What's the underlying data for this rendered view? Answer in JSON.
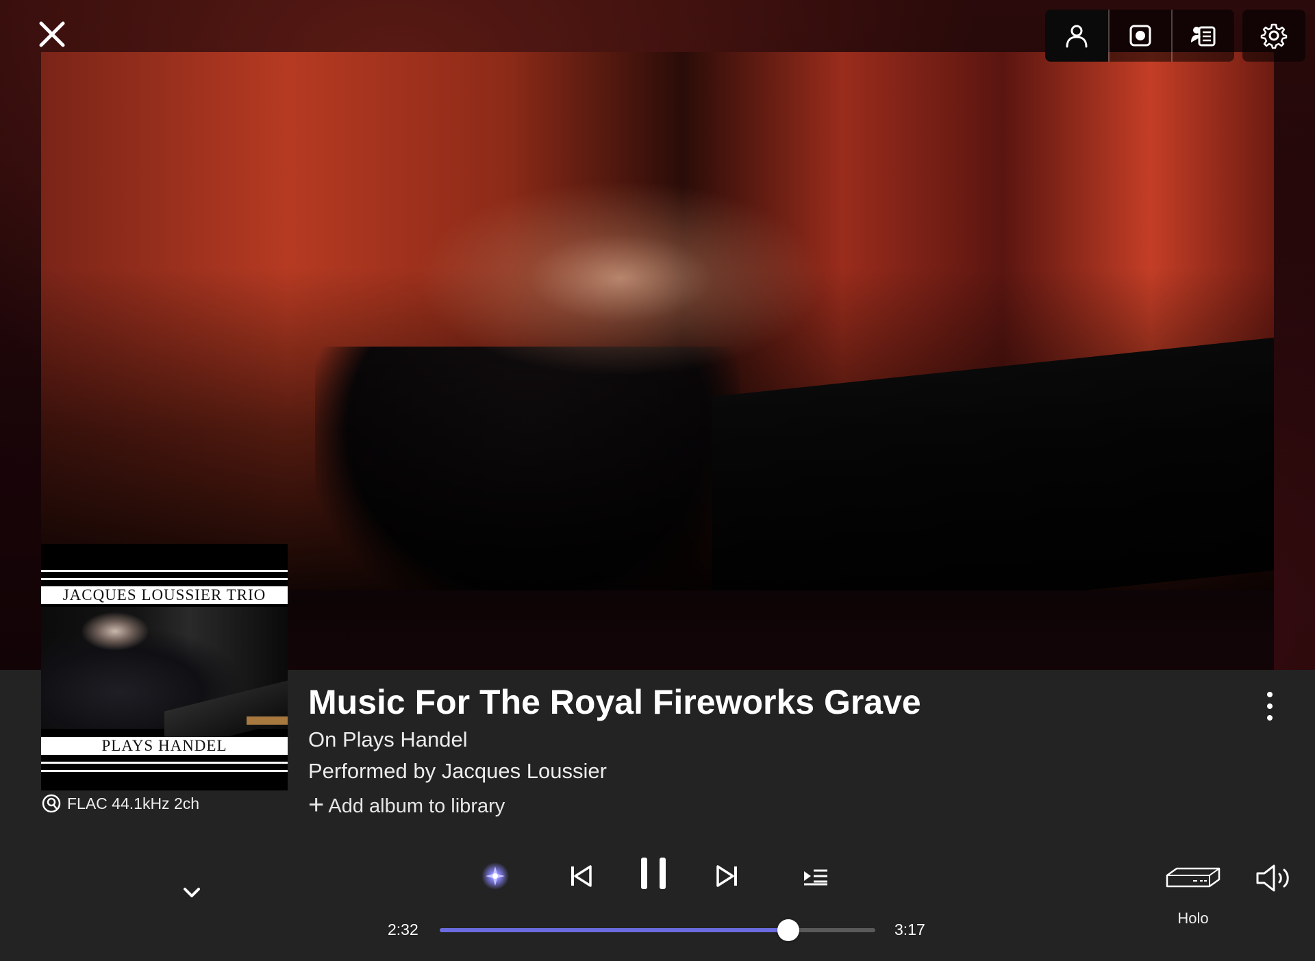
{
  "now_playing": {
    "track_title": "Music For The Royal Fireworks Grave",
    "album_line": "On Plays Handel",
    "artist_line": "Performed by Jacques Loussier",
    "add_album_label": "Add album to library",
    "format": "FLAC 44.1kHz 2ch"
  },
  "album_art": {
    "top_text": "JACQUES LOUSSIER TRIO",
    "bottom_text": "PLAYS HANDEL"
  },
  "toolbar": {
    "items": [
      "artist-view-icon",
      "album-view-icon",
      "lyrics-credits-icon",
      "settings-icon"
    ],
    "active": "artist-view-icon"
  },
  "playback": {
    "elapsed": "2:32",
    "total": "3:17",
    "progress_fraction": 0.8,
    "state": "playing"
  },
  "zone": {
    "name": "Holo",
    "icon": "audio-device-icon"
  },
  "colors": {
    "accent": "#6b6be0",
    "panel_bg": "#232323",
    "radio_glow": "#8a86ff"
  }
}
